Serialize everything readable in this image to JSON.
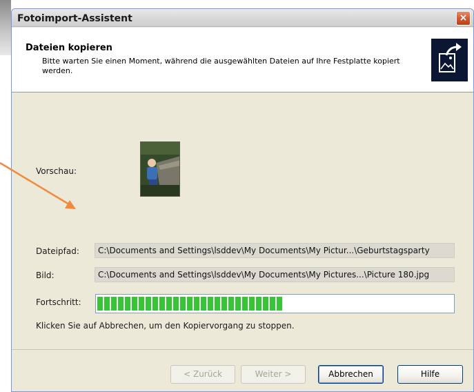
{
  "window": {
    "title": "Fotoimport-Assistent",
    "close_label": "×"
  },
  "header": {
    "title": "Dateien kopieren",
    "description": "Bitte warten Sie einen Moment, während die ausgewählten Dateien auf Ihre Festplatte kopiert werden.",
    "icon": "import-photo-icon"
  },
  "content": {
    "preview_label": "Vorschau:",
    "filepath_label": "Dateipfad:",
    "filepath_value": "C:\\Documents and Settings\\lsddev\\My Documents\\My Pictur...\\Geburtstagsparty",
    "image_label": "Bild:",
    "image_value": "C:\\Documents and Settings\\lsddev\\My Documents\\My Pictures...\\Picture 180.jpg",
    "progress_label": "Fortschritt:",
    "progress_fraction": 0.52,
    "hint": "Klicken Sie auf Abbrechen, um den Kopiervorgang zu stoppen."
  },
  "footer": {
    "back_label": "< Zurück",
    "next_label": "Weiter >",
    "cancel_label": "Abbrechen",
    "help_label": "Hilfe"
  },
  "colors": {
    "progress": "#37c537",
    "title_close": "#d2552f",
    "annotation_arrow": "#f08a3c"
  }
}
